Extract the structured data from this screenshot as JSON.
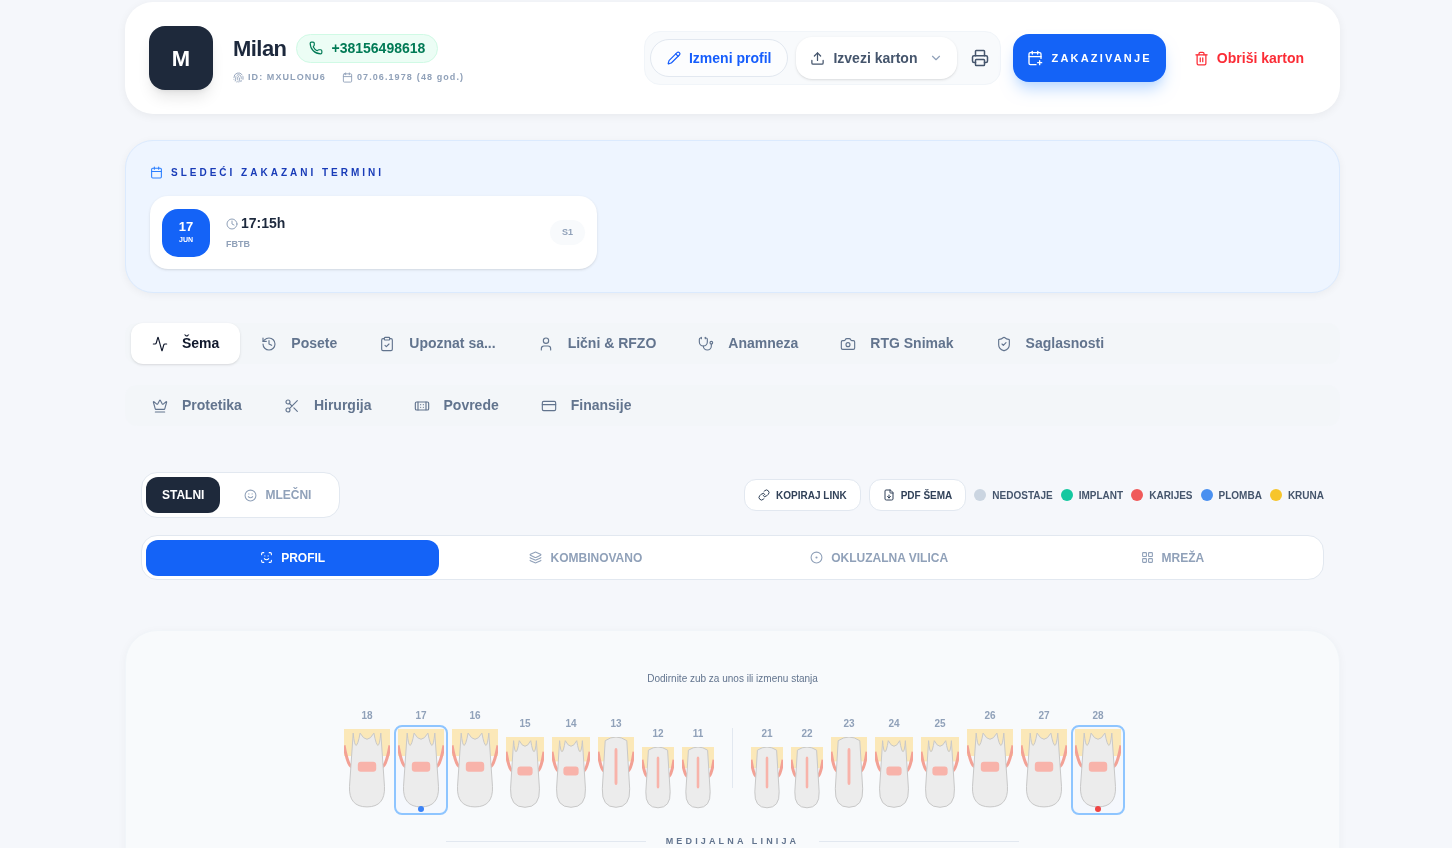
{
  "patient": {
    "initial": "M",
    "name": "Milan",
    "phone": "+38156498618",
    "id": "ID: MXULONU6",
    "birth_date": "07.06.1978",
    "age": "(48 god.)"
  },
  "actions": {
    "edit": "Izmeni profil",
    "export": "Izvezi karton",
    "schedule": "ZAKAZIVANJE",
    "delete": "Obriši karton"
  },
  "appointments": {
    "title": "SLEDEĆI ZAKAZANI TERMINI",
    "items": [
      {
        "day": "17",
        "month": "JUN",
        "time": "17:15h",
        "code": "FBTB",
        "badge": "S1"
      }
    ]
  },
  "tabs": [
    {
      "label": "Šema",
      "selected": true
    },
    {
      "label": "Posete",
      "selected": false
    },
    {
      "label": "Upoznat sa...",
      "selected": false
    },
    {
      "label": "Lični & RFZO",
      "selected": false
    },
    {
      "label": "Anamneza",
      "selected": false
    },
    {
      "label": "RTG Snimak",
      "selected": false
    },
    {
      "label": "Saglasnosti",
      "selected": false
    },
    {
      "label": "Protetika",
      "selected": false
    },
    {
      "label": "Hirurgija",
      "selected": false
    },
    {
      "label": "Povrede",
      "selected": false
    },
    {
      "label": "Finansije",
      "selected": false
    }
  ],
  "dentition": [
    {
      "label": "STALNI",
      "selected": true
    },
    {
      "label": "MLEČNI",
      "selected": false
    }
  ],
  "tools": {
    "copy_link": "KOPIRAJ LINK",
    "pdf": "PDF ŠEMA"
  },
  "legend": [
    {
      "label": "NEDOSTAJE",
      "color": "#cbd5e1"
    },
    {
      "label": "IMPLANT",
      "color": "#14c8a0"
    },
    {
      "label": "KARIJES",
      "color": "#f05a5a"
    },
    {
      "label": "PLOMBA",
      "color": "#4a90f0"
    },
    {
      "label": "KRUNA",
      "color": "#f7c52b"
    }
  ],
  "views": [
    {
      "label": "PROFIL",
      "selected": true
    },
    {
      "label": "KOMBINOVANO",
      "selected": false
    },
    {
      "label": "OKLUZALNA VILICA",
      "selected": false
    },
    {
      "label": "MREŽA",
      "selected": false
    }
  ],
  "chart": {
    "hint": "Dodirnite zub za unos ili izmenu stanja",
    "midline": "MEDIJALNA LINIJA",
    "right": [
      {
        "number": "18",
        "kind": "molar",
        "selected": false
      },
      {
        "number": "17",
        "kind": "molar",
        "selected": true,
        "color": "#3b82f6"
      },
      {
        "number": "16",
        "kind": "molar",
        "selected": false
      },
      {
        "number": "15",
        "kind": "premolar",
        "selected": false
      },
      {
        "number": "14",
        "kind": "premolar",
        "selected": false
      },
      {
        "number": "13",
        "kind": "canine",
        "selected": false
      },
      {
        "number": "12",
        "kind": "incisor",
        "selected": false
      },
      {
        "number": "11",
        "kind": "incisor",
        "selected": false
      }
    ],
    "left": [
      {
        "number": "21",
        "kind": "incisor",
        "selected": false
      },
      {
        "number": "22",
        "kind": "incisor",
        "selected": false
      },
      {
        "number": "23",
        "kind": "canine",
        "selected": false
      },
      {
        "number": "24",
        "kind": "premolar",
        "selected": false
      },
      {
        "number": "25",
        "kind": "premolar",
        "selected": false
      },
      {
        "number": "26",
        "kind": "molar",
        "selected": false
      },
      {
        "number": "27",
        "kind": "molar",
        "selected": false
      },
      {
        "number": "28",
        "kind": "molar",
        "selected": true,
        "color": "#ef4444"
      }
    ]
  }
}
